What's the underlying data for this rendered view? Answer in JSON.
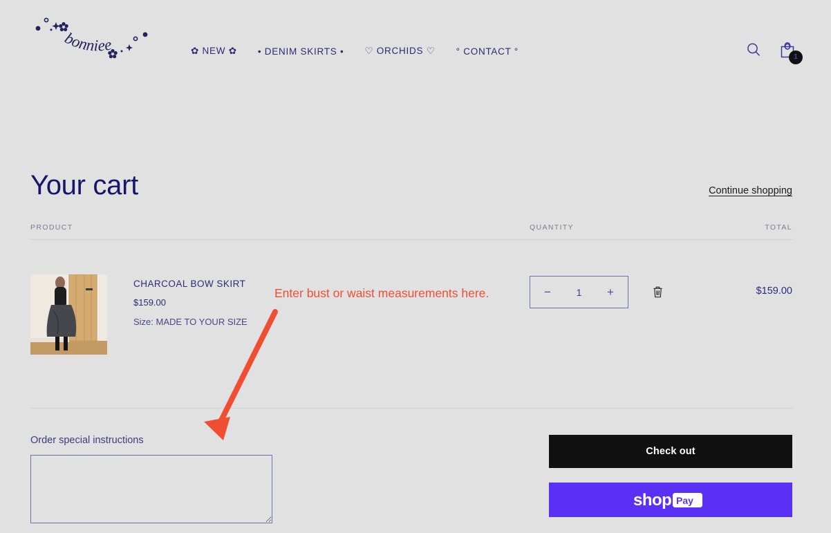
{
  "header": {
    "logo_text": "bonniee",
    "nav": [
      {
        "label": "✿ NEW ✿",
        "name": "nav-new"
      },
      {
        "label": "• DENIM SKIRTS •",
        "name": "nav-denim-skirts"
      },
      {
        "label": "♡ ORCHIDS ♡",
        "name": "nav-orchids"
      },
      {
        "label": "° CONTACT °",
        "name": "nav-contact"
      }
    ],
    "search_icon": "search-icon",
    "cart_icon": "shopping-bag-icon",
    "cart_count": "1"
  },
  "cart": {
    "title": "Your cart",
    "continue_shopping": "Continue shopping",
    "columns": {
      "product": "PRODUCT",
      "quantity": "QUANTITY",
      "total": "TOTAL"
    },
    "items": [
      {
        "title": "CHARCOAL BOW SKIRT",
        "price": "$159.00",
        "variant": "Size: MADE TO YOUR SIZE",
        "quantity": "1",
        "total": "$159.00",
        "minus_label": "−",
        "plus_label": "+",
        "remove_icon": "trash-icon"
      }
    ],
    "notes_label": "Order special instructions",
    "notes_value": "",
    "notes_placeholder": ""
  },
  "actions": {
    "checkout": "Check out",
    "shop_pay": "shop Pay"
  },
  "annotation": {
    "text": "Enter bust or waist measurements here.",
    "color": "#f04e32"
  },
  "colors": {
    "background": "#e1e1e1",
    "navy": "#2e2a72",
    "title_navy": "#16166b",
    "shop_pay_purple": "#5a31f4",
    "checkout_black": "#111111"
  }
}
